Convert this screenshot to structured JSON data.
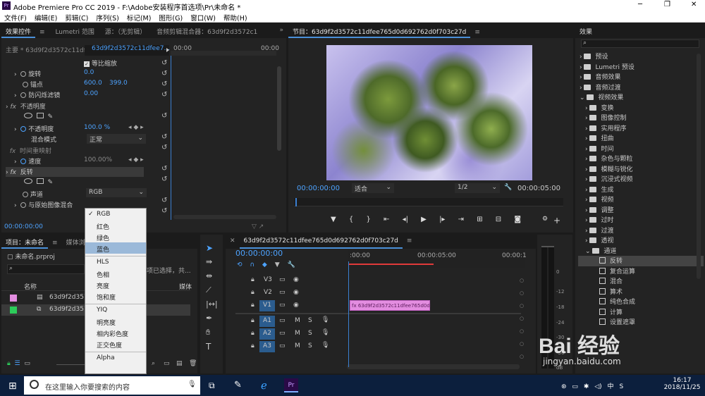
{
  "window": {
    "title": "Adobe Premiere Pro CC 2019 - F:\\Adobe安装程序首选项\\Pr\\未命名 *",
    "minimize": "─",
    "maximize": "❐",
    "close": "✕"
  },
  "menu": [
    "文件(F)",
    "编辑(E)",
    "剪辑(C)",
    "序列(S)",
    "标记(M)",
    "图形(G)",
    "窗口(W)",
    "帮助(H)"
  ],
  "effect_controls": {
    "tabs": [
      "效果控件",
      "Lumetri 范围",
      "源：（无剪辑）",
      "音频剪辑混合器：63d9f2d3572c1"
    ],
    "master": "主要 * 63d9f2d3572c11df...",
    "clip": "63d9f2d3572c11dfee7...",
    "t0": "00:00",
    "t1": "00:00",
    "uniform_scale": "等比缩放",
    "rotation": {
      "label": "旋转",
      "value": "0.0"
    },
    "anchor": {
      "label": "锚点",
      "x": "600.0",
      "y": "399.0"
    },
    "antiflicker": {
      "label": "防闪烁滤镜",
      "value": "0.00"
    },
    "opacity_section": "不透明度",
    "opacity": {
      "label": "不透明度",
      "value": "100.0 %"
    },
    "blend": {
      "label": "混合模式",
      "value": "正常"
    },
    "timeremap": "时间重映射",
    "speed": {
      "label": "速度",
      "value": "100.00%"
    },
    "invert": "反转",
    "channel": {
      "label": "声道",
      "value": "RGB"
    },
    "blendorig": {
      "label": "与原始图像混合"
    },
    "timecode": "00:00:00:00"
  },
  "dropdown": [
    "RGB",
    "红色",
    "绿色",
    "蓝色",
    "HLS",
    "色相",
    "亮度",
    "饱和度",
    "YIQ",
    "明亮度",
    "相内彩色度",
    "正交色度",
    "Alpha"
  ],
  "program": {
    "tab": "节目：63d9f2d3572c11dfee765d0d692762d0f703c27d",
    "timecode": "00:00:00:00",
    "fit": "适合",
    "quality": "1/2",
    "duration": "00:00:05:00"
  },
  "effects": {
    "title": "效果",
    "items": [
      "预设",
      "Lumetri 预设",
      "音频效果",
      "音频过渡",
      "视频效果",
      "变换",
      "图像控制",
      "实用程序",
      "扭曲",
      "时间",
      "杂色与颗粒",
      "模糊与锐化",
      "沉浸式视频",
      "生成",
      "视频",
      "调整",
      "过时",
      "过渡",
      "透视",
      "通道",
      "反转",
      "复合运算",
      "混合",
      "算术",
      "纯色合成",
      "计算",
      "设置遮罩"
    ]
  },
  "project": {
    "tabs": [
      "项目：未命名",
      "媒体浏览器"
    ],
    "file": "未命名.prproj",
    "hint": "项已选择，共...",
    "col_name": "名称",
    "col_media": "媒体",
    "items": [
      "63d9f2d3572c11df",
      "63d9f2d3572c11df"
    ],
    "item_color": "#e38de0",
    "item2_color": "#2dcc5a"
  },
  "timeline": {
    "tab": "63d9f2d3572c11dfee765d0d692762d0f703c27d",
    "timecode": "00:00:00:00",
    "r0": ":00:00",
    "r1": "00:00:05:00",
    "r2": "00:00:1",
    "tracks_v": [
      "V3",
      "V2",
      "V1"
    ],
    "tracks_a": [
      "A1",
      "A2",
      "A3"
    ],
    "clip": "63d9f2d3572c11dfee765d0d69",
    "m": "M",
    "s": "S"
  },
  "meter": [
    "0",
    "-12",
    "-18",
    "-24",
    "-30",
    "-36",
    "-42",
    "-48",
    "-54",
    "dB"
  ],
  "taskbar": {
    "search": "在这里输入你要搜索的内容",
    "time": "16:17",
    "date": "2018/11/25"
  },
  "watermark": {
    "brand": "Bai 经验",
    "url": "jingyan.baidu.com"
  }
}
